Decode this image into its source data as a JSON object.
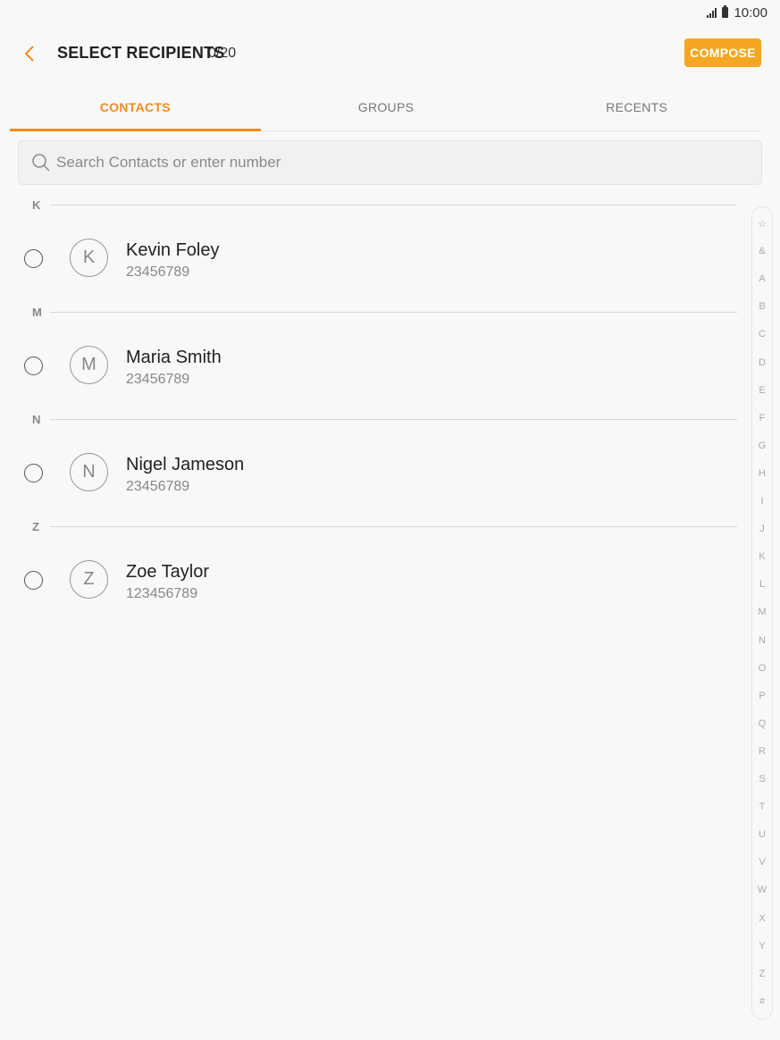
{
  "status_bar": {
    "time": "10:00"
  },
  "header": {
    "title": "SELECT RECIPIENTS",
    "count": "0/20",
    "compose_label": "COMPOSE"
  },
  "tabs": [
    {
      "label": "CONTACTS",
      "active": true
    },
    {
      "label": "GROUPS",
      "active": false
    },
    {
      "label": "RECENTS",
      "active": false
    }
  ],
  "search": {
    "placeholder": "Search Contacts or enter number",
    "value": ""
  },
  "sections": [
    {
      "letter": "K",
      "contacts": [
        {
          "initial": "K",
          "name": "Kevin Foley",
          "number": "23456789"
        }
      ]
    },
    {
      "letter": "M",
      "contacts": [
        {
          "initial": "M",
          "name": "Maria Smith",
          "number": "23456789"
        }
      ]
    },
    {
      "letter": "N",
      "contacts": [
        {
          "initial": "N",
          "name": "Nigel Jameson",
          "number": "23456789"
        }
      ]
    },
    {
      "letter": "Z",
      "contacts": [
        {
          "initial": "Z",
          "name": "Zoe Taylor",
          "number": "123456789"
        }
      ]
    }
  ],
  "index_letters": [
    "☆",
    "&",
    "A",
    "B",
    "C",
    "D",
    "E",
    "F",
    "G",
    "H",
    "I",
    "J",
    "K",
    "L",
    "M",
    "N",
    "O",
    "P",
    "Q",
    "R",
    "S",
    "T",
    "U",
    "V",
    "W",
    "X",
    "Y",
    "Z",
    "#"
  ],
  "colors": {
    "accent": "#f08c1e",
    "compose_bg": "#f5a623"
  }
}
